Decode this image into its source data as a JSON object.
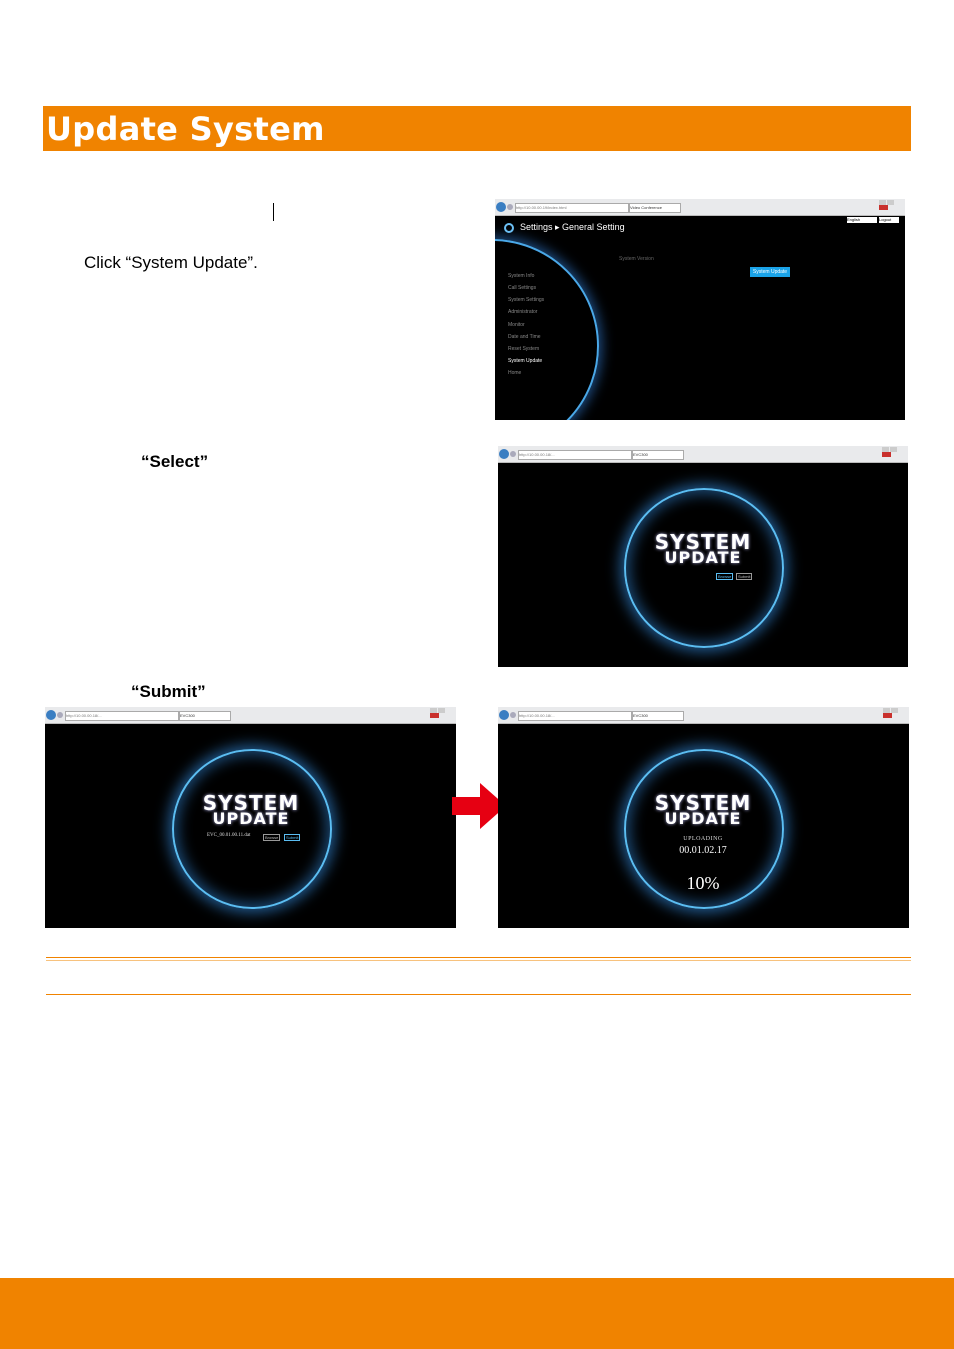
{
  "section_title": "Update System",
  "steps": {
    "step1": "Click “System Update”.",
    "step2_keyword": "“Select”",
    "step3_keyword": "“Submit”"
  },
  "screenshot_settings": {
    "address": "http://10.00.00.19/index.html",
    "tab": "Video Conference",
    "header": "Settings ▸ General Setting",
    "language": "English",
    "logout": "Logout",
    "system_version_label": "System Version",
    "system_update_button": "System Update",
    "menu": [
      "System Info",
      "Call Settings",
      "System Settings",
      "Administrator",
      "Monitor",
      "Date and Time",
      "Reset System",
      "System Update",
      "Home"
    ],
    "active_menu": "System Update"
  },
  "screenshot_select": {
    "address": "http://10.00.00.18/...",
    "tab": "EVC300",
    "title_line1": "SYSTEM",
    "title_line2": "UPDATE",
    "browse_label": "Browse",
    "submit_label": "Submit"
  },
  "screenshot_submit": {
    "address": "http://10.00.00.18/...",
    "tab": "EVC300",
    "title_line1": "SYSTEM",
    "title_line2": "UPDATE",
    "file_name": "EVC_00.01.00.11.dat",
    "browse_label": "Browse",
    "submit_label": "Submit"
  },
  "screenshot_uploading": {
    "address": "http://10.00.00.18/...",
    "tab": "EVC300",
    "title_line1": "SYSTEM",
    "title_line2": "UPDATE",
    "status": "UPLOADING",
    "version": "00.01.02.17",
    "progress_text": "10%",
    "progress": 0.1
  },
  "colors": {
    "accent": "#f08300",
    "arrow": "#e60012",
    "glow": "#5bbdf2"
  }
}
